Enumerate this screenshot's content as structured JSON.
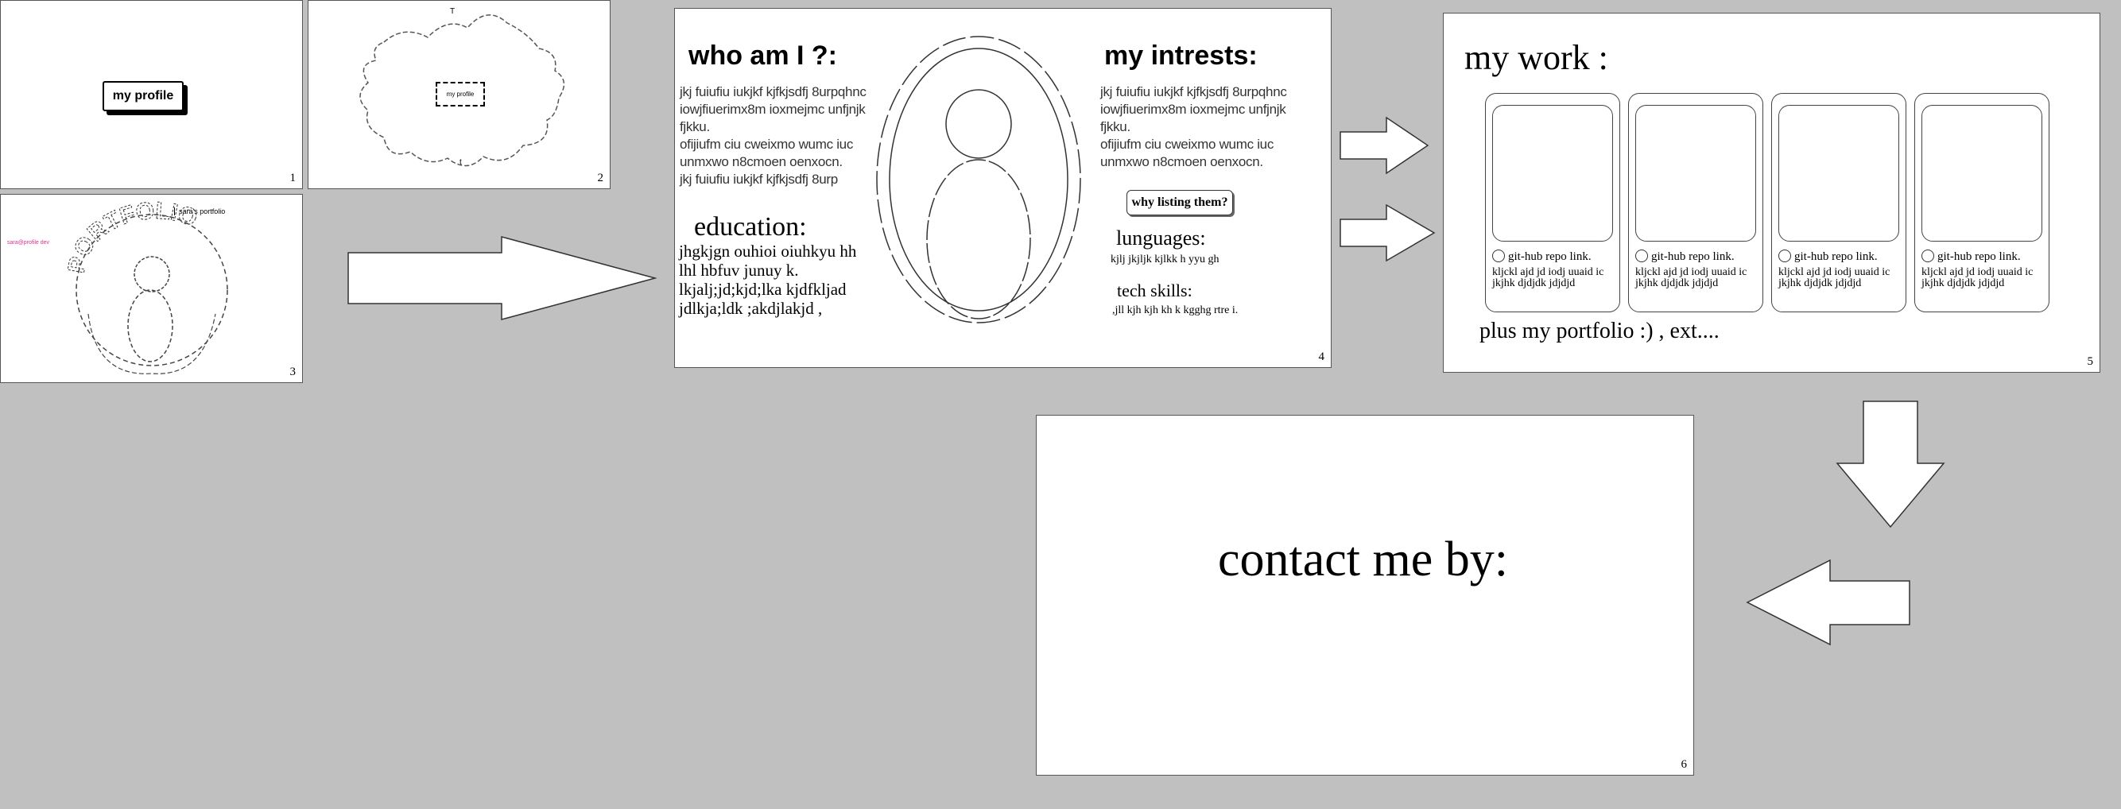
{
  "slides": {
    "s1": {
      "number": "1",
      "button_label": "my profile"
    },
    "s2": {
      "number": "2",
      "button_label": "my profile",
      "top_mark": "T",
      "bottom_mark": "t"
    },
    "s3": {
      "number": "3",
      "heading": "sara's portfolio",
      "pink_text": "sara@profile dev",
      "circle_text": "PORTFOLIO"
    },
    "s4": {
      "number": "4",
      "who_title": "who am I ?:",
      "who_lines": [
        "jkj fuiufiu iukjkf kjfkjsdfj 8urpqhnc",
        "iowjfiuerimx8m ioxmejmc unfjnjk",
        "fjkku.",
        "ofijiufm  ciu cweixmo wumc iuc",
        "unmxwo n8cmoen oenxocn.",
        "jkj fuiufiu iukjkf kjfkjsdfj 8urp"
      ],
      "education_title": "education:",
      "education_lines": [
        "jhgkjgn ouhioi  oiuhkyu hh",
        "lhl hbfuv junuy k.",
        "lkjalj;jd;kjd;lka kjdfkljad",
        "jdlkja;ldk ;akdjlakjd ,"
      ],
      "interests_title": "my intrests:",
      "interest_lines": [
        "jkj fuiufiu iukjkf kjfkjsdfj 8urpqhnc",
        "iowjfiuerimx8m ioxmejmc unfjnjk",
        "fjkku.",
        "ofijiufm  ciu cweixmo wumc iuc",
        "unmxwo n8cmoen oenxocn."
      ],
      "why_button": "why listing them?",
      "languages_title": "lunguages:",
      "languages_text": "kjlj jkjljk kjlkk  h yyu gh",
      "tech_title": "tech skills:",
      "tech_text": ",jll kjh kjh kh k kgghg rtre i."
    },
    "s5": {
      "number": "5",
      "title": "my work :",
      "cards": [
        {
          "repo": "git-hub repo link.",
          "desc": "kljckl ajd jd iodj uuaid ic jkjhk djdjdk jdjdjd"
        },
        {
          "repo": "git-hub repo link.",
          "desc": "kljckl ajd jd iodj uuaid ic jkjhk djdjdk jdjdjd"
        },
        {
          "repo": "git-hub repo link.",
          "desc": "kljckl ajd jd iodj uuaid ic jkjhk djdjdk jdjdjd"
        },
        {
          "repo": "git-hub repo link.",
          "desc": "kljckl ajd jd iodj uuaid ic jkjhk djdjdk jdjdjd"
        }
      ],
      "footer": "plus my portfolio :) , ext...."
    },
    "s6": {
      "number": "6",
      "title": "contact me by:",
      "dot": "."
    }
  },
  "colors": {
    "background": "#c0c0c0",
    "pink": "#e03090"
  }
}
